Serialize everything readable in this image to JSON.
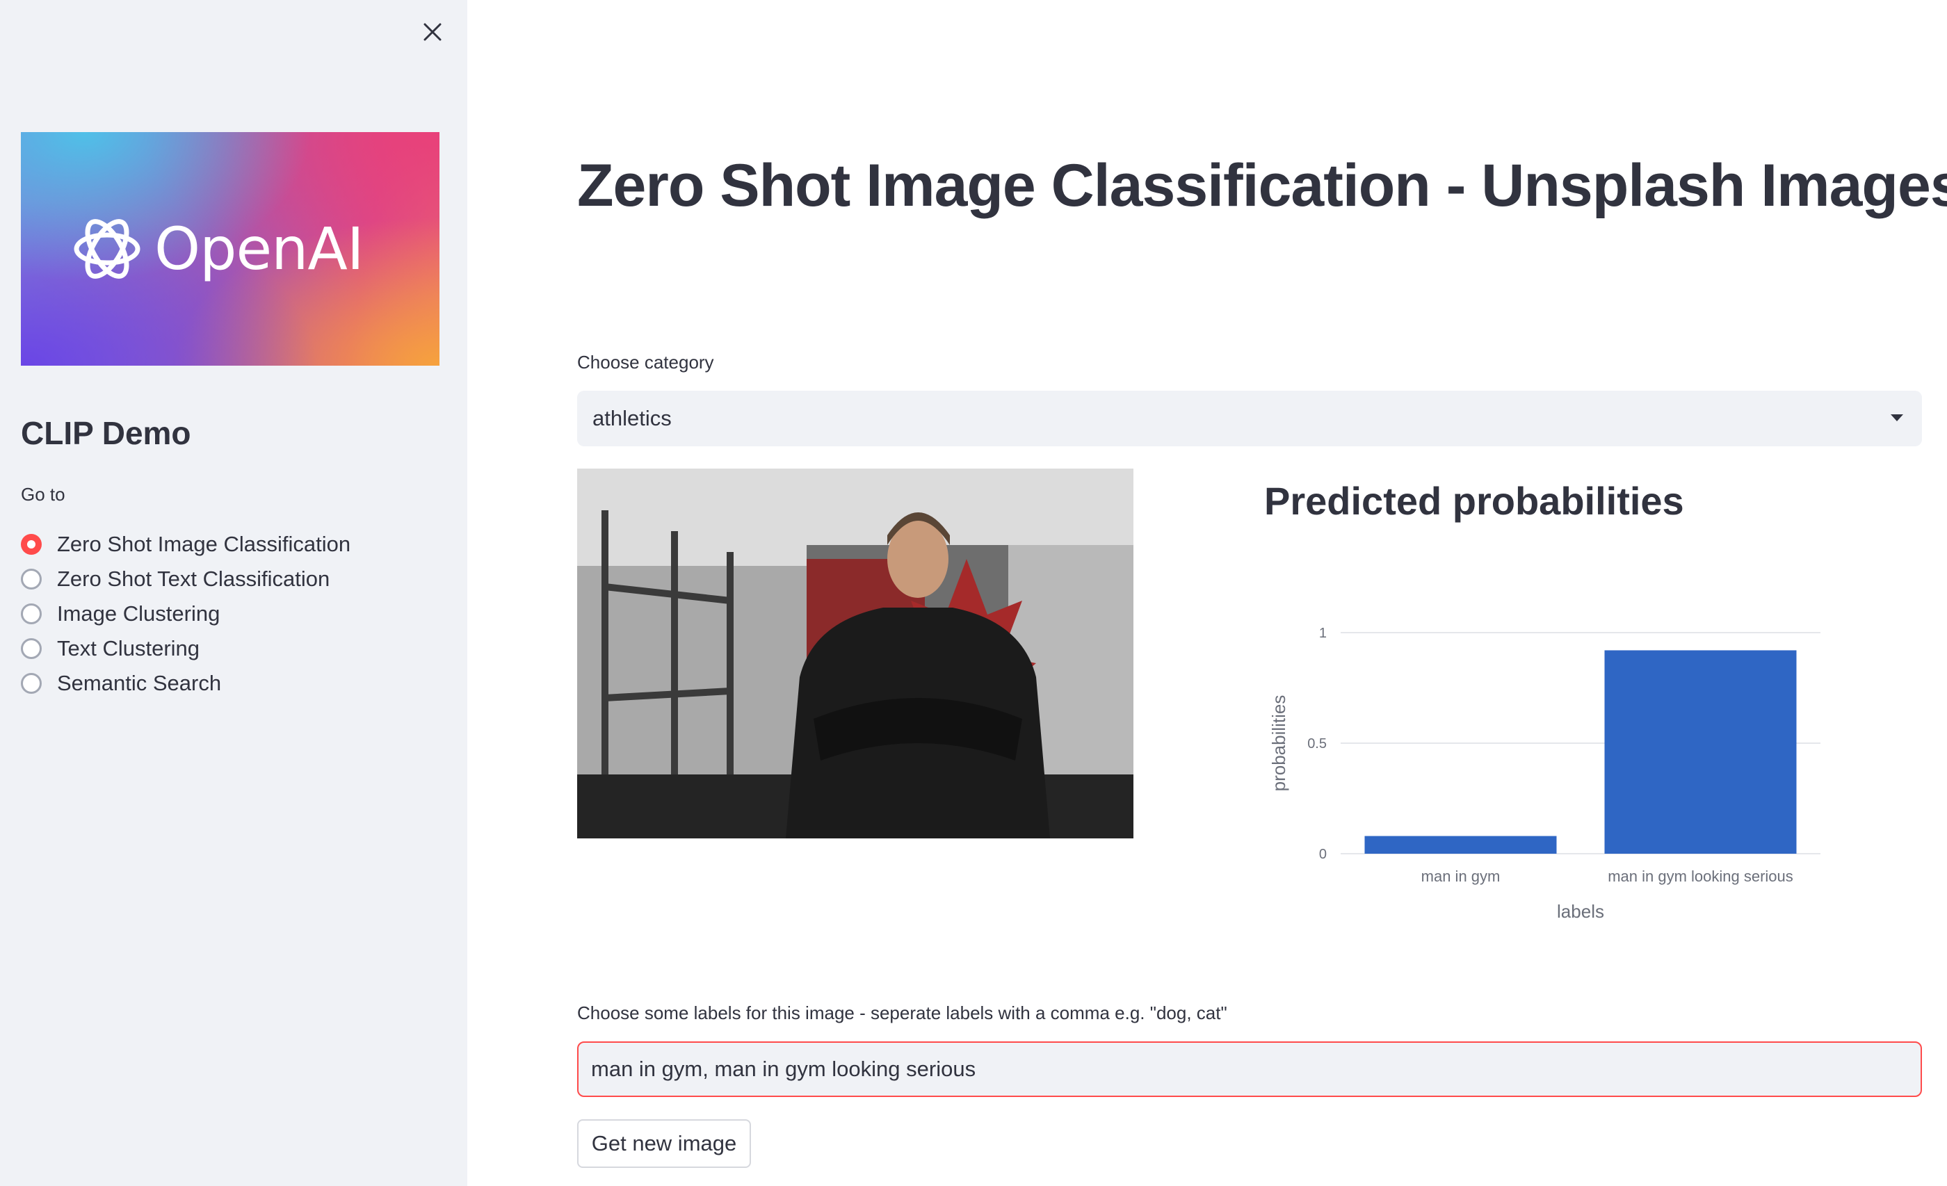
{
  "sidebar": {
    "close_icon": "close-icon",
    "logo_text": "OpenAI",
    "title": "CLIP Demo",
    "goto_label": "Go to",
    "nav_items": [
      {
        "label": "Zero Shot Image Classification",
        "selected": true
      },
      {
        "label": "Zero Shot Text Classification",
        "selected": false
      },
      {
        "label": "Image Clustering",
        "selected": false
      },
      {
        "label": "Text Clustering",
        "selected": false
      },
      {
        "label": "Semantic Search",
        "selected": false
      }
    ]
  },
  "main": {
    "title": "Zero Shot Image Classification - Unsplash Images",
    "category": {
      "label": "Choose category",
      "value": "athletics"
    },
    "chart_heading": "Predicted probabilities",
    "labels_input": {
      "label": "Choose some labels for this image - seperate labels with a comma e.g. \"dog, cat\"",
      "value": "man in gym, man in gym looking serious"
    },
    "new_image_button": "Get new image"
  },
  "colors": {
    "accent": "#ff4b4b",
    "bar": "#2f66c4",
    "sidebar_bg": "#f0f2f6"
  },
  "chart_data": {
    "type": "bar",
    "categories": [
      "man in gym",
      "man in gym looking serious"
    ],
    "values": [
      0.08,
      0.92
    ],
    "xlabel": "labels",
    "ylabel": "probabilities",
    "ylim": [
      0,
      1
    ],
    "yticks": [
      "0",
      "0.5",
      "1"
    ],
    "grid": true
  }
}
